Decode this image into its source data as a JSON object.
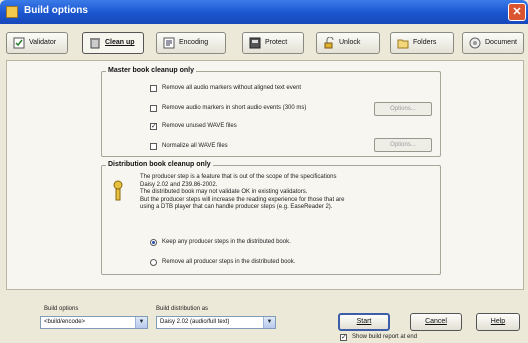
{
  "window": {
    "title": "Build options",
    "close_glyph": "✕"
  },
  "toolbar": {
    "tabs": [
      {
        "label": "Validator",
        "icon": "validator-icon"
      },
      {
        "label": "Clean up",
        "icon": "clean-up-icon",
        "active": true
      },
      {
        "label": "Encoding",
        "icon": "encoding-icon"
      },
      {
        "label": "Protect",
        "icon": "protect-icon"
      },
      {
        "label": "Unlock",
        "icon": "unlock-icon"
      },
      {
        "label": "Folders",
        "icon": "folders-icon"
      },
      {
        "label": "Document",
        "icon": "document-icon"
      }
    ]
  },
  "master_group": {
    "title": "Master book cleanup only",
    "options": [
      {
        "label": "Remove all audio markers without aligned text event",
        "checked": false
      },
      {
        "label": "Remove audio markers in short audio events (300 ms)",
        "checked": false
      },
      {
        "label": "Remove unused WAVE files",
        "checked": true
      },
      {
        "label": "Normalize all WAVE files",
        "checked": false
      }
    ],
    "options_button": "Options..."
  },
  "distribution_group": {
    "title": "Distribution book cleanup only",
    "description": [
      "The producer step is a feature that is out of the scope of the specifications",
      "Daisy 2.02 and Z39.86-2002.",
      "The distributed book may not validate OK in existing validators.",
      "But the producer steps will increase the reading experience for those that are",
      "using a DTB player that can handle producer steps (e.g. EaseReader 2)."
    ],
    "radios": [
      {
        "label": "Keep any producer steps in the distributed book.",
        "selected": true
      },
      {
        "label": "Remove all producer steps in the distributed book.",
        "selected": false
      }
    ]
  },
  "bottom": {
    "build_options_label": "Build options",
    "build_options_value": "<build/encode>",
    "build_distribution_label": "Build distribution as",
    "build_distribution_value": "Daisy 2.02 (audio/full text)",
    "start_button": "Start",
    "cancel_button": "Cancel",
    "help_button": "Help",
    "show_after_label": "Show build report at end",
    "show_after_checked": true
  },
  "colors": {
    "title_bar": "#1a55cf",
    "panel": "#ece9d8",
    "accent": "#3c5da8"
  }
}
